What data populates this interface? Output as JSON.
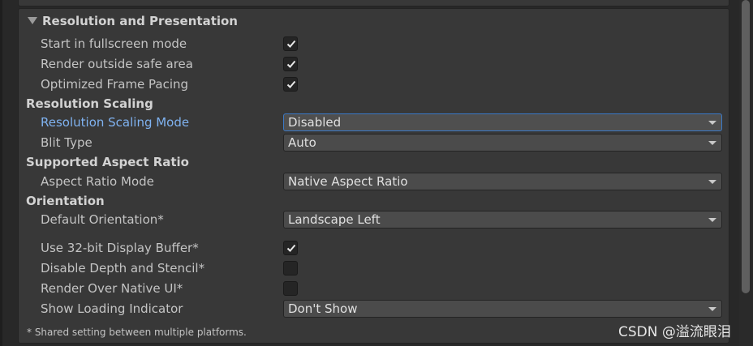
{
  "section": {
    "title": "Resolution and Presentation"
  },
  "settings": {
    "start_fullscreen": {
      "label": "Start in fullscreen mode",
      "checked": true
    },
    "render_outside_safe_area": {
      "label": "Render outside safe area",
      "checked": true
    },
    "optimized_frame_pacing": {
      "label": "Optimized Frame Pacing",
      "checked": true
    },
    "resolution_scaling_header": "Resolution Scaling",
    "resolution_scaling_mode": {
      "label": "Resolution Scaling Mode",
      "value": "Disabled"
    },
    "blit_type": {
      "label": "Blit Type",
      "value": "Auto"
    },
    "supported_aspect_ratio_header": "Supported Aspect Ratio",
    "aspect_ratio_mode": {
      "label": "Aspect Ratio Mode",
      "value": "Native Aspect Ratio"
    },
    "orientation_header": "Orientation",
    "default_orientation": {
      "label": "Default Orientation*",
      "value": "Landscape Left"
    },
    "use_32bit_display_buffer": {
      "label": "Use 32-bit Display Buffer*",
      "checked": true
    },
    "disable_depth_and_stencil": {
      "label": "Disable Depth and Stencil*",
      "checked": false
    },
    "render_over_native_ui": {
      "label": "Render Over Native UI*",
      "checked": false
    },
    "show_loading_indicator": {
      "label": "Show Loading Indicator",
      "value": "Don't Show"
    }
  },
  "footnote": "* Shared setting between multiple platforms.",
  "watermark": "CSDN @溢流眼泪",
  "icons": {
    "checkmark": "checkmark-icon",
    "dropdown_arrow": "chevron-down-icon",
    "foldout": "foldout-triangle-icon"
  },
  "colors": {
    "background": "#282828",
    "panel": "#383838",
    "active_label": "#7fb2f0",
    "focus_border": "#3b79c6"
  }
}
